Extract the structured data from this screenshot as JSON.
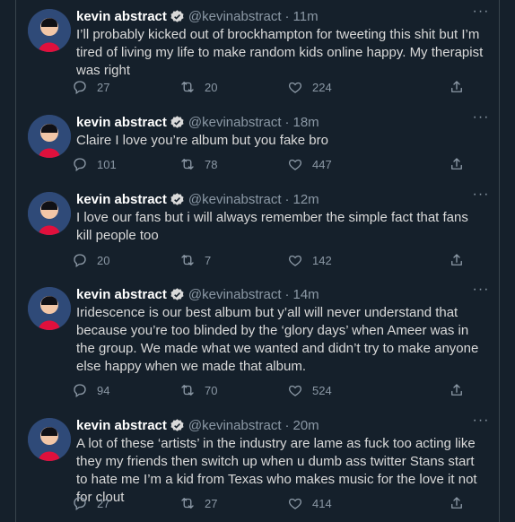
{
  "tweets": [
    {
      "name": "kevin abstract",
      "handle": "@kevinabstract",
      "time": "11m",
      "text": "I’ll probably kicked out of brockhampton for tweeting this shit but I’m tired of living my life to make random kids online happy. My therapist was right",
      "replies": "27",
      "retweets": "20",
      "likes": "224"
    },
    {
      "name": "kevin abstract",
      "handle": "@kevinabstract",
      "time": "18m",
      "text": "Claire  I love you’re album but you fake bro",
      "replies": "101",
      "retweets": "78",
      "likes": "447"
    },
    {
      "name": "kevin abstract",
      "handle": "@kevinabstract",
      "time": "12m",
      "text": "I love our fans but i will always remember the simple fact that fans kill people too",
      "replies": "20",
      "retweets": "7",
      "likes": "142"
    },
    {
      "name": "kevin abstract",
      "handle": "@kevinabstract",
      "time": "14m",
      "text": "Iridescence is our best album but y’all will never understand that because you’re too blinded by the ‘glory days’ when Ameer was in the group.  We made what we wanted and didn’t try to make anyone else happy when we made that album.",
      "replies": "94",
      "retweets": "70",
      "likes": "524"
    },
    {
      "name": "kevin abstract",
      "handle": "@kevinabstract",
      "time": "20m",
      "text": "A lot of these ‘artists’ in the industry are lame as fuck too acting like they my friends then switch up when u dumb ass twitter Stans start to hate me I’m a kid from Texas who makes music for the love it not for clout",
      "replies": "27",
      "retweets": "27",
      "likes": "414"
    }
  ],
  "separator": "·",
  "more_glyph": "···",
  "colors": {
    "background": "#15202b",
    "border": "#38444d",
    "secondary_text": "#8b98a5",
    "verified": "#d9d9d9"
  },
  "icons": {
    "reply": "reply-icon",
    "retweet": "retweet-icon",
    "like": "like-icon",
    "share": "share-icon",
    "verified": "verified-badge-icon",
    "more": "more-icon"
  }
}
